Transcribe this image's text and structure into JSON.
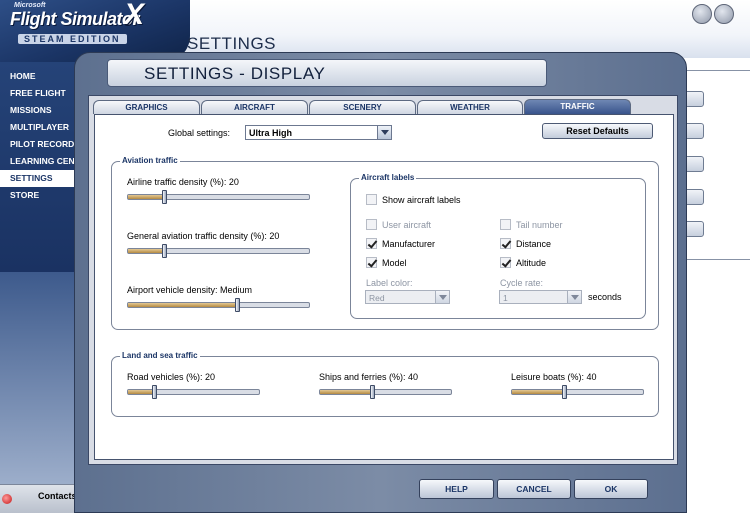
{
  "app": {
    "logo_microsoft": "Microsoft",
    "logo_name": "Flight Simulator",
    "logo_x": "X",
    "logo_edition": "STEAM EDITION",
    "page_title": "SETTINGS"
  },
  "sidebar": {
    "items": [
      {
        "label": "HOME"
      },
      {
        "label": "FREE FLIGHT"
      },
      {
        "label": "MISSIONS"
      },
      {
        "label": "MULTIPLAYER"
      },
      {
        "label": "PILOT RECORDS"
      },
      {
        "label": "LEARNING CENTER"
      },
      {
        "label": "SETTINGS",
        "active": true
      },
      {
        "label": "STORE"
      }
    ]
  },
  "contacts": {
    "label": "Contacts"
  },
  "dialog": {
    "title": "SETTINGS - DISPLAY",
    "tabs": [
      {
        "label": "GRAPHICS"
      },
      {
        "label": "AIRCRAFT"
      },
      {
        "label": "SCENERY"
      },
      {
        "label": "WEATHER"
      },
      {
        "label": "TRAFFIC",
        "active": true
      }
    ],
    "global_settings": {
      "label": "Global settings:",
      "value": "Ultra High"
    },
    "reset_label": "Reset Defaults",
    "aviation": {
      "title": "Aviation traffic",
      "airline": {
        "label": "Airline traffic density (%): 20",
        "value": 20
      },
      "general": {
        "label": "General aviation traffic density (%): 20",
        "value": 20
      },
      "airport": {
        "label": "Airport vehicle density: Medium",
        "value": 0.6
      }
    },
    "aircraft_labels": {
      "title": "Aircraft labels",
      "show": {
        "label": "Show aircraft labels",
        "checked": false
      },
      "user_aircraft": {
        "label": "User aircraft",
        "checked": false
      },
      "tail_number": {
        "label": "Tail number",
        "checked": false
      },
      "manufacturer": {
        "label": "Manufacturer",
        "checked": true
      },
      "distance": {
        "label": "Distance",
        "checked": true
      },
      "model": {
        "label": "Model",
        "checked": true
      },
      "altitude": {
        "label": "Altitude",
        "checked": true
      },
      "label_color": {
        "label": "Label color:",
        "value": "Red"
      },
      "cycle_rate": {
        "label": "Cycle rate:",
        "value": "1",
        "unit": "seconds"
      }
    },
    "land_sea": {
      "title": "Land and sea traffic",
      "road": {
        "label": "Road vehicles (%): 20",
        "value": 20
      },
      "ships": {
        "label": "Ships and ferries (%): 40",
        "value": 40
      },
      "leisure": {
        "label": "Leisure boats (%): 40",
        "value": 40
      }
    },
    "buttons": {
      "help": "HELP",
      "cancel": "CANCEL",
      "ok": "OK"
    }
  },
  "colors": {
    "brand_dark_blue": "#1b3566",
    "slider_fill": "#b48a43",
    "dialog_frame": "#6b7d9b"
  }
}
